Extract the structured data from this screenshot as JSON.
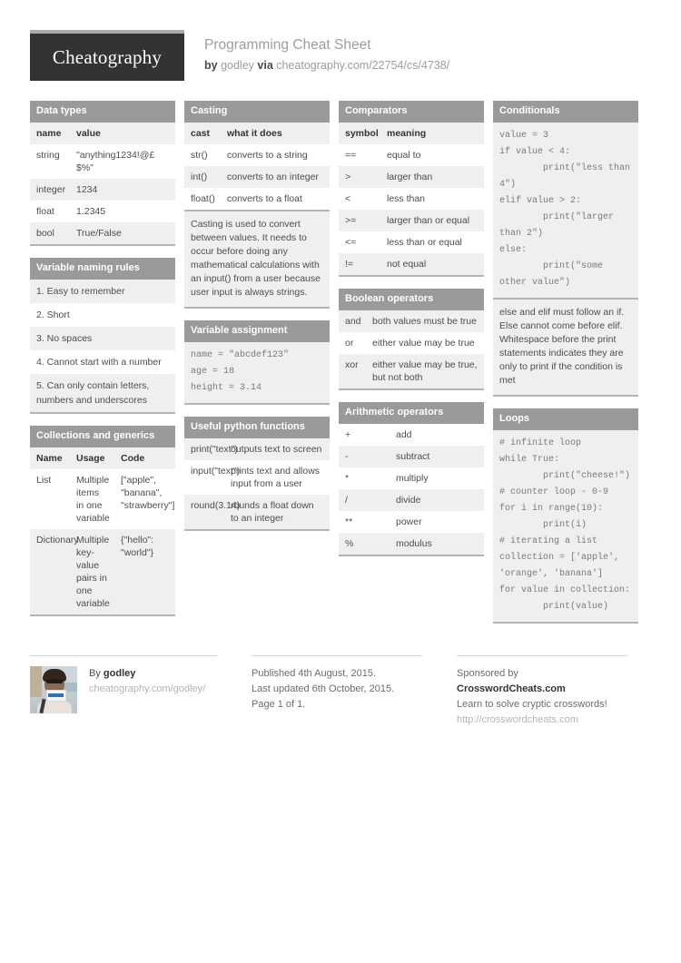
{
  "header": {
    "logo_text": "Cheatography",
    "title": "Programming Cheat Sheet",
    "by_label": "by",
    "author": "godley",
    "via_label": "via",
    "source_url": "cheatography.com/22754/cs/4738/"
  },
  "cards": {
    "data_types": {
      "title": "Data types",
      "headers": [
        "name",
        "value"
      ],
      "rows": [
        [
          "string",
          "\"anything1234!@£$%\""
        ],
        [
          "integer",
          "1234"
        ],
        [
          "float",
          "1.2345"
        ],
        [
          "bool",
          "True/False"
        ]
      ]
    },
    "variable_naming_rules": {
      "title": "Variable naming rules",
      "items": [
        "1. Easy to remember",
        "2. Short",
        "3. No spaces",
        "4. Cannot start with a number",
        "5. Can only contain letters, numbers and underscores"
      ]
    },
    "collections_and_generics": {
      "title": "Collections and generics",
      "headers": [
        "Name",
        "Usage",
        "Code"
      ],
      "rows": [
        [
          "List",
          "Multiple items in one variable",
          "[\"apple\", \"banana\", \"strawberry\"]"
        ],
        [
          "Dictionary",
          "Multiple key-value pairs in one variable",
          "{\"hello\": \"world\"}"
        ]
      ]
    },
    "casting": {
      "title": "Casting",
      "headers": [
        "cast",
        "what it does"
      ],
      "rows": [
        [
          "str()",
          "converts to a string"
        ],
        [
          "int()",
          "converts to an integer"
        ],
        [
          "float()",
          "converts to a float"
        ]
      ],
      "note": "Casting is used to convert between values. It needs to occur before doing any mathematical calculations with an input() from a user because user input is always strings."
    },
    "variable_assignment": {
      "title": "Variable assignment",
      "code": "name = \"abcdef123\"\nage = 18\nheight = 3.14"
    },
    "useful_python_functions": {
      "title": "Useful python functions",
      "rows": [
        [
          "print(\"text\")",
          "outputs text to screen"
        ],
        [
          "input(\"text\")",
          "prints text and allows input from a user"
        ],
        [
          "round(3.14)",
          "rounds a float down to an integer"
        ]
      ]
    },
    "comparators": {
      "title": "Comparators",
      "headers": [
        "symbol",
        "meaning"
      ],
      "rows": [
        [
          "==",
          "equal to"
        ],
        [
          ">",
          "larger than"
        ],
        [
          "<",
          "less than"
        ],
        [
          ">=",
          "larger than or equal"
        ],
        [
          "<=",
          "less than or equal"
        ],
        [
          "!=",
          "not equal"
        ]
      ]
    },
    "boolean_operators": {
      "title": "Boolean operators",
      "rows": [
        [
          "and",
          "both values must be true"
        ],
        [
          "or",
          "either value may be true"
        ],
        [
          "xor",
          "either value may be true, but not both"
        ]
      ]
    },
    "arithmetic_operators": {
      "title": "Arithmetic operators",
      "rows": [
        [
          "+",
          "add"
        ],
        [
          "-",
          "subtract"
        ],
        [
          "*",
          "multiply"
        ],
        [
          "/",
          "divide"
        ],
        [
          "**",
          "power"
        ],
        [
          "%",
          "modulus"
        ]
      ]
    },
    "conditionals": {
      "title": "Conditionals",
      "code": "value = 3\nif value < 4:\n        print(\"less than 4\")\nelif value > 2:\n        print(\"larger than 2\")\nelse:\n        print(\"some other value\")",
      "note": "else and elif must follow an if. Else cannot come before elif. Whitespace before the print statements indicates they are only to print if the condition is met"
    },
    "loops": {
      "title": "Loops",
      "code": "# infinite loop\nwhile True:\n        print(\"cheese!\")\n# counter loop - 0-9\nfor i in range(10):\n        print(i)\n# iterating a list\ncollection = ['apple', 'orange', 'banana']\nfor value in collection:\n        print(value)"
    }
  },
  "footer": {
    "author": {
      "by_label": "By",
      "name": "godley",
      "profile_url": "cheatography.com/godley/"
    },
    "publication": {
      "published": "Published 4th August, 2015.",
      "updated": "Last updated 6th October, 2015.",
      "page": "Page 1 of 1."
    },
    "sponsor": {
      "prefix": "Sponsored by",
      "name": "CrosswordCheats.com",
      "tagline": "Learn to solve cryptic crosswords!",
      "url": "http://crosswordcheats.com"
    }
  }
}
